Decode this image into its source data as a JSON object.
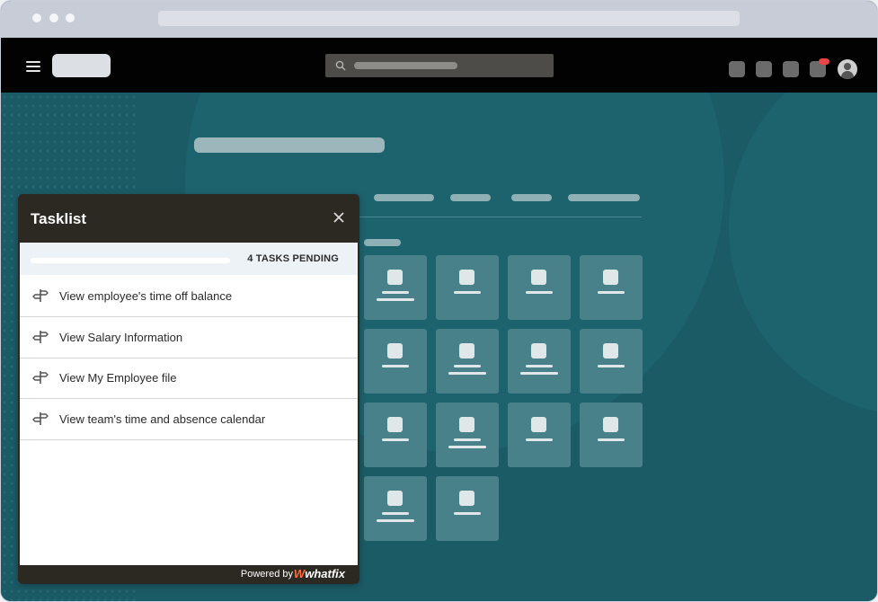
{
  "tasklist": {
    "title": "Tasklist",
    "pending_label": "4 TASKS PENDING",
    "progress": 0,
    "items": [
      {
        "label": "View employee's time off balance",
        "icon": "signpost-icon"
      },
      {
        "label": "View Salary Information",
        "icon": "signpost-icon"
      },
      {
        "label": "View My Employee file",
        "icon": "signpost-icon"
      },
      {
        "label": "View team's time and absence calendar",
        "icon": "signpost-icon"
      }
    ],
    "footer": {
      "powered_by": "Powered by",
      "brand_mark": "W",
      "brand_name": "whatfix"
    }
  },
  "colors": {
    "app_background": "#1b5b66",
    "tasklist_dark": "#2c2822",
    "brand_accent": "#ff6a3d",
    "notification_badge": "#e94545"
  }
}
